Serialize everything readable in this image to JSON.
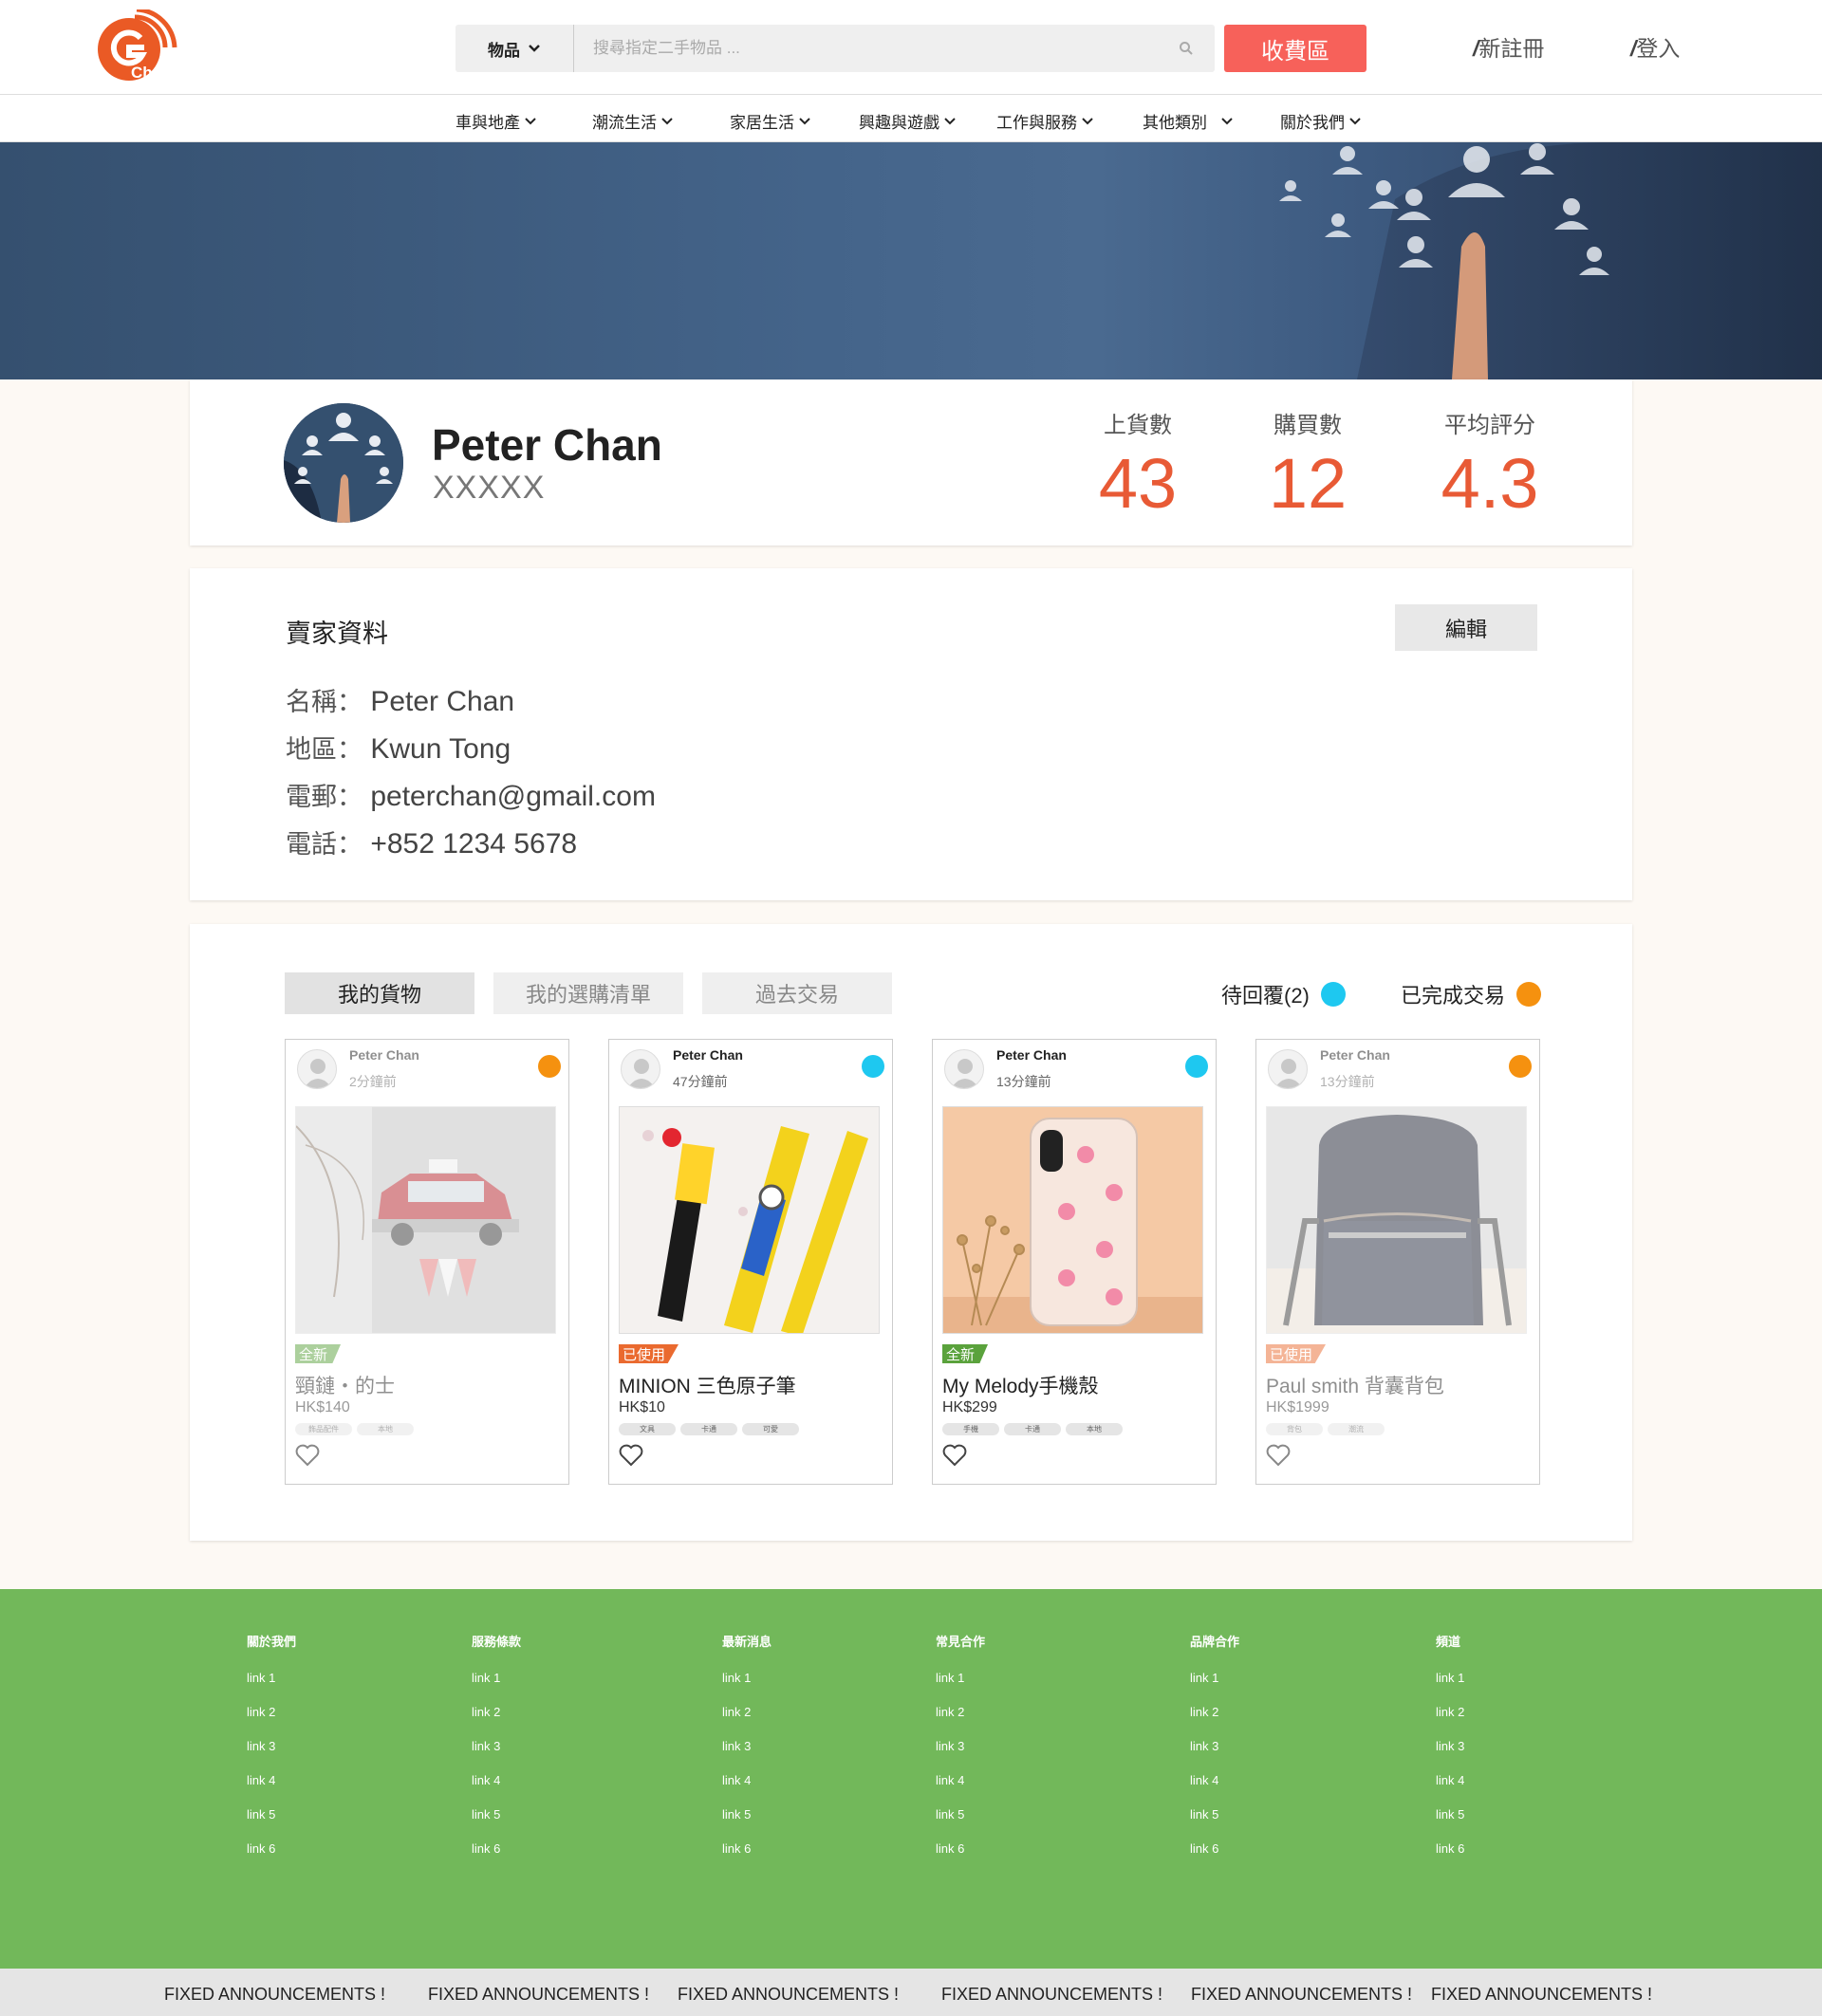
{
  "header": {
    "logo_text": "Change",
    "search_category": "物品",
    "search_placeholder": "搜尋指定二手物品 ...",
    "sell_button": "收費區",
    "register": "新註冊",
    "login": "登入",
    "slash": "/"
  },
  "nav": [
    "車與地產",
    "潮流生活",
    "家居生活",
    "興趣與遊戲",
    "工作與服務",
    "其他類別",
    "關於我們"
  ],
  "profile": {
    "name": "Peter Chan",
    "subtitle": "XXXXX",
    "stats": [
      {
        "label": "上貨數",
        "value": "43"
      },
      {
        "label": "購買數",
        "value": "12"
      },
      {
        "label": "平均評分",
        "value": "4.3"
      }
    ]
  },
  "seller_info": {
    "title": "賣家資料",
    "edit": "編輯",
    "rows": [
      {
        "label": "名稱：",
        "value": "Peter Chan"
      },
      {
        "label": "地區：",
        "value": "Kwun Tong"
      },
      {
        "label": "電郵：",
        "value": "peterchan@gmail.com"
      },
      {
        "label": "電話：",
        "value": "+852 1234 5678"
      }
    ]
  },
  "goods": {
    "tabs": [
      "我的貨物",
      "我的選購清單",
      "過去交易"
    ],
    "legend": [
      {
        "label": "待回覆(2)",
        "color": "#1ec8f0"
      },
      {
        "label": "已完成交易",
        "color": "#f5910f"
      }
    ],
    "items": [
      {
        "seller": "Peter Chan",
        "time": "2分鐘前",
        "status_color": "#f5910f",
        "badge": "全新",
        "badge_color": "#5aa23c",
        "title": "頸鏈・的士",
        "price": "HK$140",
        "tags": [
          "飾品配件",
          "本地"
        ]
      },
      {
        "seller": "Peter Chan",
        "time": "47分鐘前",
        "status_color": "#1ec8f0",
        "badge": "已使用",
        "badge_color": "#ea6a2f",
        "title": "MINION 三色原子筆",
        "price": "HK$10",
        "tags": [
          "文具",
          "卡通",
          "可愛"
        ]
      },
      {
        "seller": "Peter Chan",
        "time": "13分鐘前",
        "status_color": "#1ec8f0",
        "badge": "全新",
        "badge_color": "#5aa23c",
        "title": "My Melody手機殼",
        "price": "HK$299",
        "tags": [
          "手機",
          "卡通",
          "本地"
        ]
      },
      {
        "seller": "Peter Chan",
        "time": "13分鐘前",
        "status_color": "#f5910f",
        "badge": "已使用",
        "badge_color": "#ea6a2f",
        "title": "Paul smith 背囊背包",
        "price": "HK$1999",
        "tags": [
          "背包",
          "潮流"
        ]
      }
    ]
  },
  "footer": {
    "columns": [
      {
        "title": "關於我們",
        "links": [
          "link 1",
          "link 2",
          "link 3",
          "link 4",
          "link 5",
          "link 6"
        ]
      },
      {
        "title": "服務條款",
        "links": [
          "link 1",
          "link 2",
          "link 3",
          "link 4",
          "link 5",
          "link 6"
        ]
      },
      {
        "title": "最新消息",
        "links": [
          "link 1",
          "link 2",
          "link 3",
          "link 4",
          "link 5",
          "link 6"
        ]
      },
      {
        "title": "常見合作",
        "links": [
          "link 1",
          "link 2",
          "link 3",
          "link 4",
          "link 5",
          "link 6"
        ]
      },
      {
        "title": "品牌合作",
        "links": [
          "link 1",
          "link 2",
          "link 3",
          "link 4",
          "link 5",
          "link 6"
        ]
      },
      {
        "title": "頻道",
        "links": [
          "link 1",
          "link 2",
          "link 3",
          "link 4",
          "link 5",
          "link 6"
        ]
      }
    ],
    "announcements": [
      "FIXED ANNOUNCEMENTS !",
      "FIXED ANNOUNCEMENTS !",
      "FIXED ANNOUNCEMENTS !",
      "FIXED ANNOUNCEMENTS !",
      "FIXED ANNOUNCEMENTS !",
      "FIXED ANNOUNCEMENTS !"
    ]
  },
  "colors": {
    "accent": "#e85a35",
    "sell_button": "#f7615a",
    "footer_bg": "#72b85a"
  }
}
